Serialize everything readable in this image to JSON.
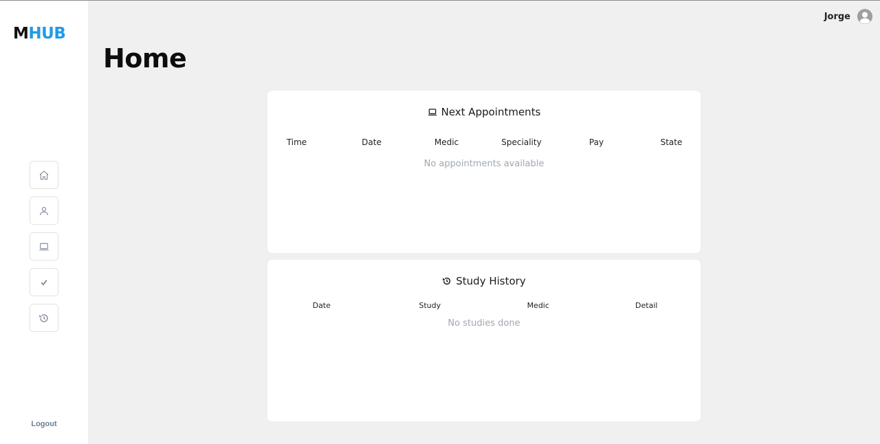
{
  "logo": {
    "part1": "M",
    "part2": "HUB"
  },
  "sidebar": {
    "items": [
      {
        "icon": "home-icon"
      },
      {
        "icon": "user-icon"
      },
      {
        "icon": "laptop-icon"
      },
      {
        "icon": "check-icon"
      },
      {
        "icon": "history-icon"
      }
    ],
    "logout_label": "Logout"
  },
  "header": {
    "user_name": "Jorge"
  },
  "page": {
    "title": "Home"
  },
  "appointments": {
    "title": "Next Appointments",
    "columns": [
      "Time",
      "Date",
      "Medic",
      "Speciality",
      "Pay",
      "State"
    ],
    "empty_text": "No appointments available"
  },
  "history": {
    "title": "Study History",
    "columns": [
      "Date",
      "Study",
      "Medic",
      "Detail"
    ],
    "empty_text": "No studies done"
  },
  "colors": {
    "accent": "#1e9be9",
    "background": "#f0f0f0",
    "muted": "#a0a7b2"
  }
}
